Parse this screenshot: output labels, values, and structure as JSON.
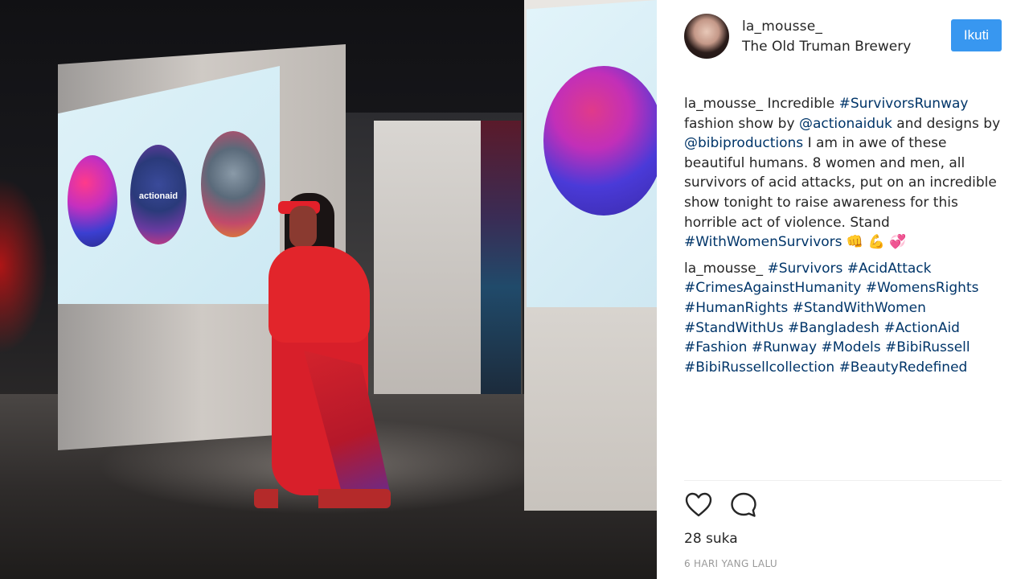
{
  "post": {
    "username": "la_mousse_",
    "location": "The Old Truman Brewery",
    "follow_label": "Ikuti",
    "photo_brand_text": "actionaid",
    "caption": {
      "user": "la_mousse_",
      "t1": " Incredible ",
      "tag_survivors_runway": "#SurvivorsRunway",
      "t2": " fashion show by ",
      "mention_actionaiduk": "@actionaiduk",
      "t3": " and designs by ",
      "mention_bibiproductions": "@bibiproductions",
      "t4": " I am in awe of these beautiful humans. 8 women and men, all survivors of acid attacks, put on an incredible show tonight to raise awareness for this horrible act of violence. Stand ",
      "tag_with_women_survivors": "#WithWomenSurvivors",
      "emojis": " 👊 💪 💞"
    },
    "comment": {
      "user": "la_mousse_",
      "hashtags": [
        "#Survivors",
        "#AcidAttack",
        "#CrimesAgainstHumanity",
        "#WomensRights",
        "#HumanRights",
        "#StandWithWomen",
        "#StandWithUs",
        "#Bangladesh",
        "#ActionAid",
        "#Fashion",
        "#Runway",
        "#Models",
        "#BibiRussell",
        "#BibiRussellcollection",
        "#BeautyRedefined"
      ]
    },
    "likes": "28 suka",
    "timestamp": "6 HARI YANG LALU"
  },
  "icons": {
    "like": "heart-outline-icon",
    "comment": "speech-bubble-icon"
  },
  "colors": {
    "follow_button": "#3897f0",
    "link": "#003569",
    "text": "#262626",
    "muted": "#999999"
  }
}
